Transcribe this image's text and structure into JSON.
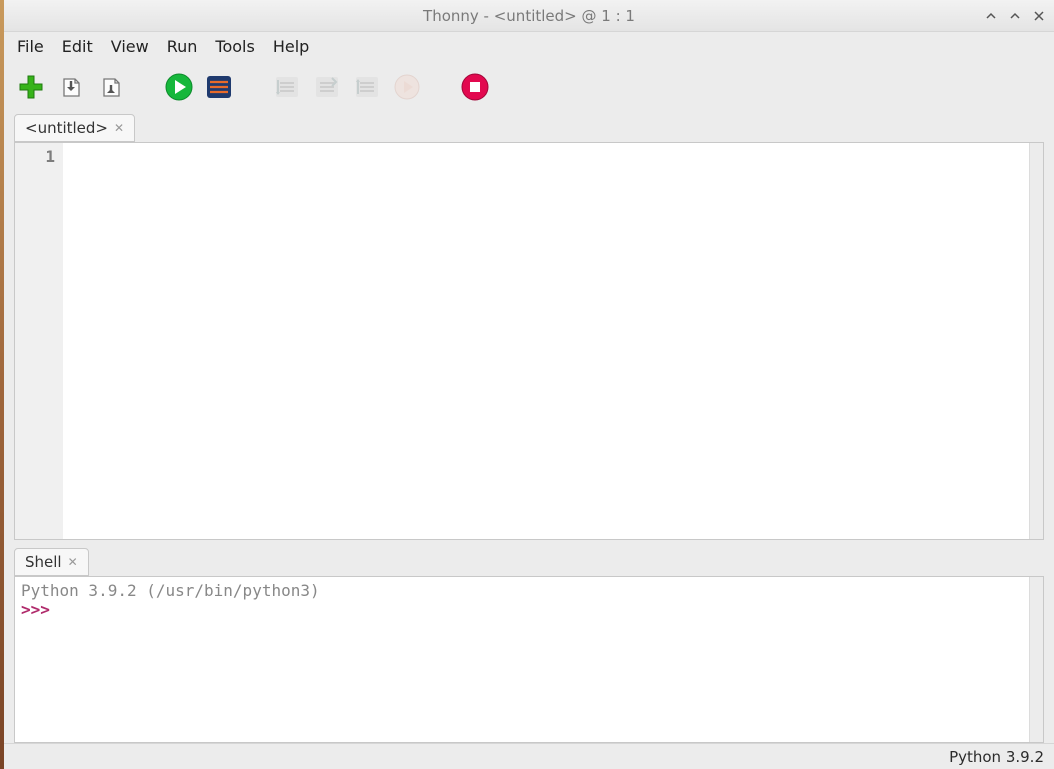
{
  "window": {
    "title": "Thonny  -  <untitled>  @  1 : 1"
  },
  "menu": {
    "items": [
      "File",
      "Edit",
      "View",
      "Run",
      "Tools",
      "Help"
    ]
  },
  "toolbar": {
    "new": "new-file",
    "open": "open-file",
    "save": "save-file",
    "run": "run",
    "debug": "debug",
    "step_over": "step-over",
    "step_into": "step-into",
    "step_out": "step-out",
    "resume": "resume",
    "stop": "stop"
  },
  "editor": {
    "tab_label": "<untitled>",
    "line_number": "1",
    "content": ""
  },
  "shell": {
    "tab_label": "Shell",
    "header_line": "Python 3.9.2 (/usr/bin/python3)",
    "prompt": ">>> "
  },
  "status": {
    "interpreter": "Python 3.9.2"
  }
}
